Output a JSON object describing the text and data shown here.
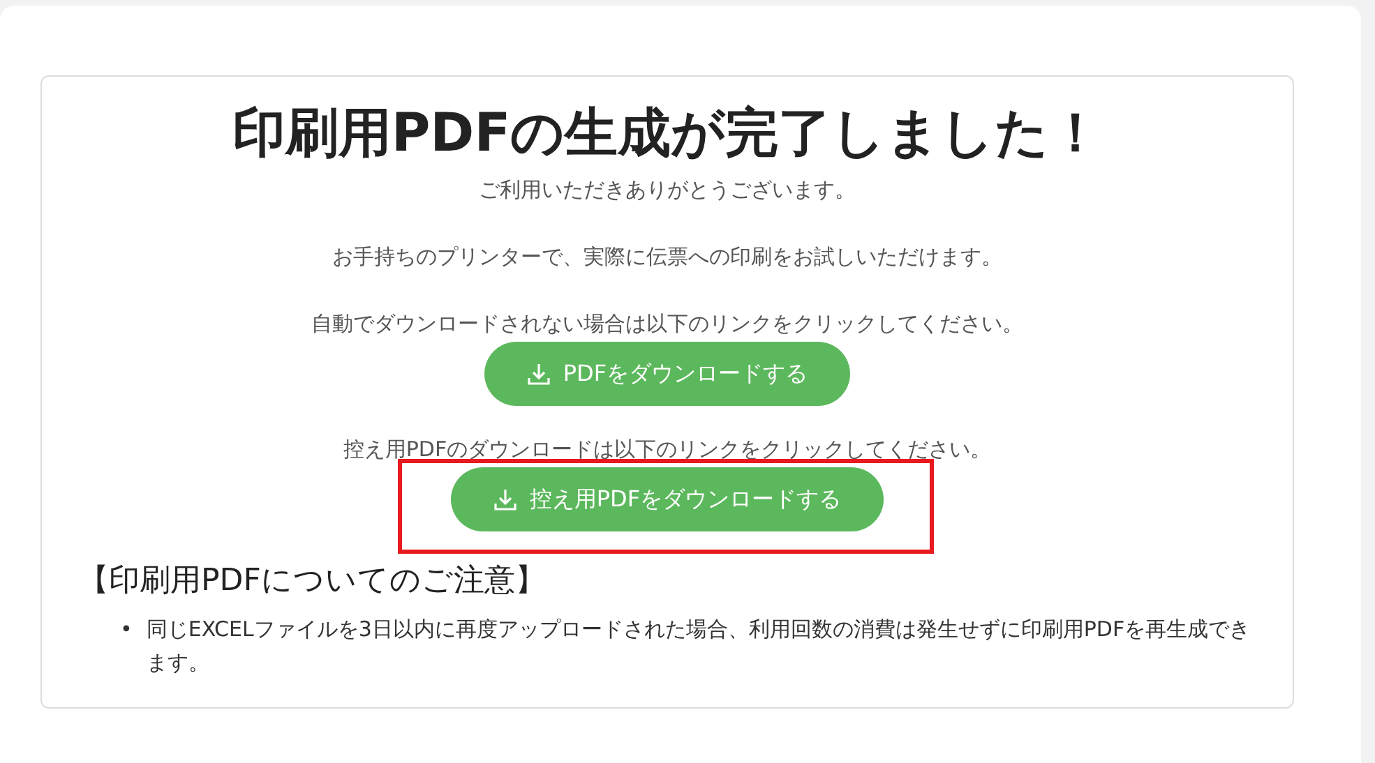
{
  "title": "印刷用PDFの生成が完了しました！",
  "messages": [
    "ご利用いただきありがとうございます。",
    "お手持ちのプリンターで、実際に伝票への印刷をお試しいただけます。"
  ],
  "downloads": [
    {
      "text": "自動でダウンロードされない場合は以下のリンクをクリックしてください。",
      "button": "PDFをダウンロードする"
    },
    {
      "text": "控え用PDFのダウンロードは以下のリンクをクリックしてください。",
      "button": "控え用PDFをダウンロードする",
      "highlighted": true
    }
  ],
  "notes": {
    "heading": "【印刷用PDFについてのご注意】",
    "bullet": "•",
    "items": [
      "同じEXCELファイルを3日以内に再度アップロードされた場合、利用回数の消費は発生せずに印刷用PDFを再生成できます。"
    ]
  }
}
